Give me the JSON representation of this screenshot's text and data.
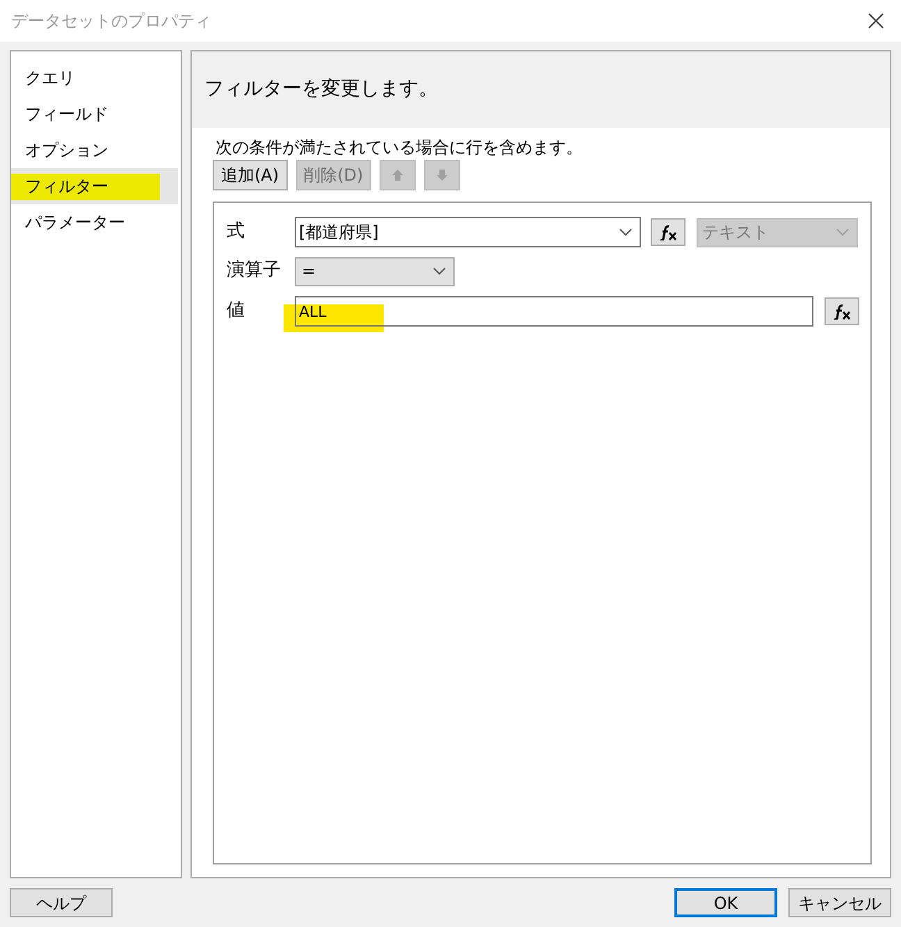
{
  "window": {
    "title": "データセットのプロパティ"
  },
  "sidebar": {
    "items": [
      {
        "label": "クエリ",
        "selected": false,
        "highlighted": false
      },
      {
        "label": "フィールド",
        "selected": false,
        "highlighted": false
      },
      {
        "label": "オプション",
        "selected": false,
        "highlighted": false
      },
      {
        "label": "フィルター",
        "selected": true,
        "highlighted": true
      },
      {
        "label": "パラメーター",
        "selected": false,
        "highlighted": false
      }
    ]
  },
  "header": "フィルターを変更します。",
  "instruction": "次の条件が満たされている場合に行を含めます。",
  "toolbar": [
    {
      "kind": "text",
      "label": "追加(A)",
      "disabled": false
    },
    {
      "kind": "text",
      "label": "削除(D)",
      "disabled": true
    },
    {
      "kind": "up",
      "disabled": true
    },
    {
      "kind": "down",
      "disabled": true
    }
  ],
  "filter": {
    "expression": {
      "label": "式",
      "value": "[都道府県]",
      "type": "テキスト",
      "type_disabled": true
    },
    "operator": {
      "label": "演算子",
      "value": "="
    },
    "value": {
      "label": "値",
      "value": "ALL",
      "highlighted": true
    }
  },
  "buttons": {
    "help": "ヘルプ",
    "ok": "OK",
    "cancel": "キャンセル"
  }
}
